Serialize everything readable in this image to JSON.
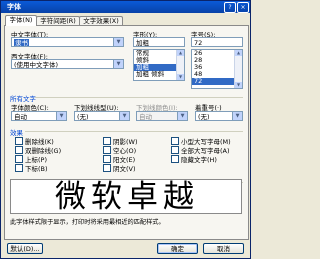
{
  "window": {
    "title": "字体",
    "help_glyph": "?",
    "close_glyph": "×"
  },
  "tabs": [
    {
      "label": "字体(N)"
    },
    {
      "label": "字符间距(R)"
    },
    {
      "label": "文字效果(X)"
    }
  ],
  "font": {
    "chinese_label": "中文字体(T):",
    "chinese_value": "隶书",
    "western_label": "西文字体(F):",
    "western_value": "(使用中文字体)",
    "style_label": "字形(Y):",
    "style_value": "加粗",
    "style_options": [
      "常规",
      "倾斜",
      "加粗",
      "加粗 倾斜"
    ],
    "style_selected_index": 2,
    "size_label": "字号(S):",
    "size_value": "72",
    "size_options": [
      "26",
      "28",
      "36",
      "48",
      "72"
    ],
    "size_selected_index": 4
  },
  "all_text": {
    "section_label": "所有文字",
    "color_label": "字体颜色(C):",
    "color_value": "自动",
    "underline_label": "下划线线型(U):",
    "underline_value": "(无)",
    "underline_color_label": "下划线颜色(I):",
    "underline_color_value": "自动",
    "emphasis_label": "着重号(·)",
    "emphasis_value": "(无)"
  },
  "effects": {
    "section_label": "效果",
    "items": [
      {
        "label": "删除线(K)"
      },
      {
        "label": "双删除线(G)"
      },
      {
        "label": "上标(P)"
      },
      {
        "label": "下标(B)"
      },
      {
        "label": "阴影(W)"
      },
      {
        "label": "空心(O)"
      },
      {
        "label": "阳文(E)"
      },
      {
        "label": "阴文(V)"
      },
      {
        "label": "小型大写字母(M)"
      },
      {
        "label": "全部大写字母(A)"
      },
      {
        "label": "隐藏文字(H)"
      }
    ]
  },
  "preview": {
    "section_label": "预览",
    "text": "微软卓越",
    "note": "此字体样式限于显示，打印时将采用最相近的匹配样式。"
  },
  "buttons": {
    "default_label": "默认(D)...",
    "ok_label": "确定",
    "cancel_label": "取消"
  }
}
